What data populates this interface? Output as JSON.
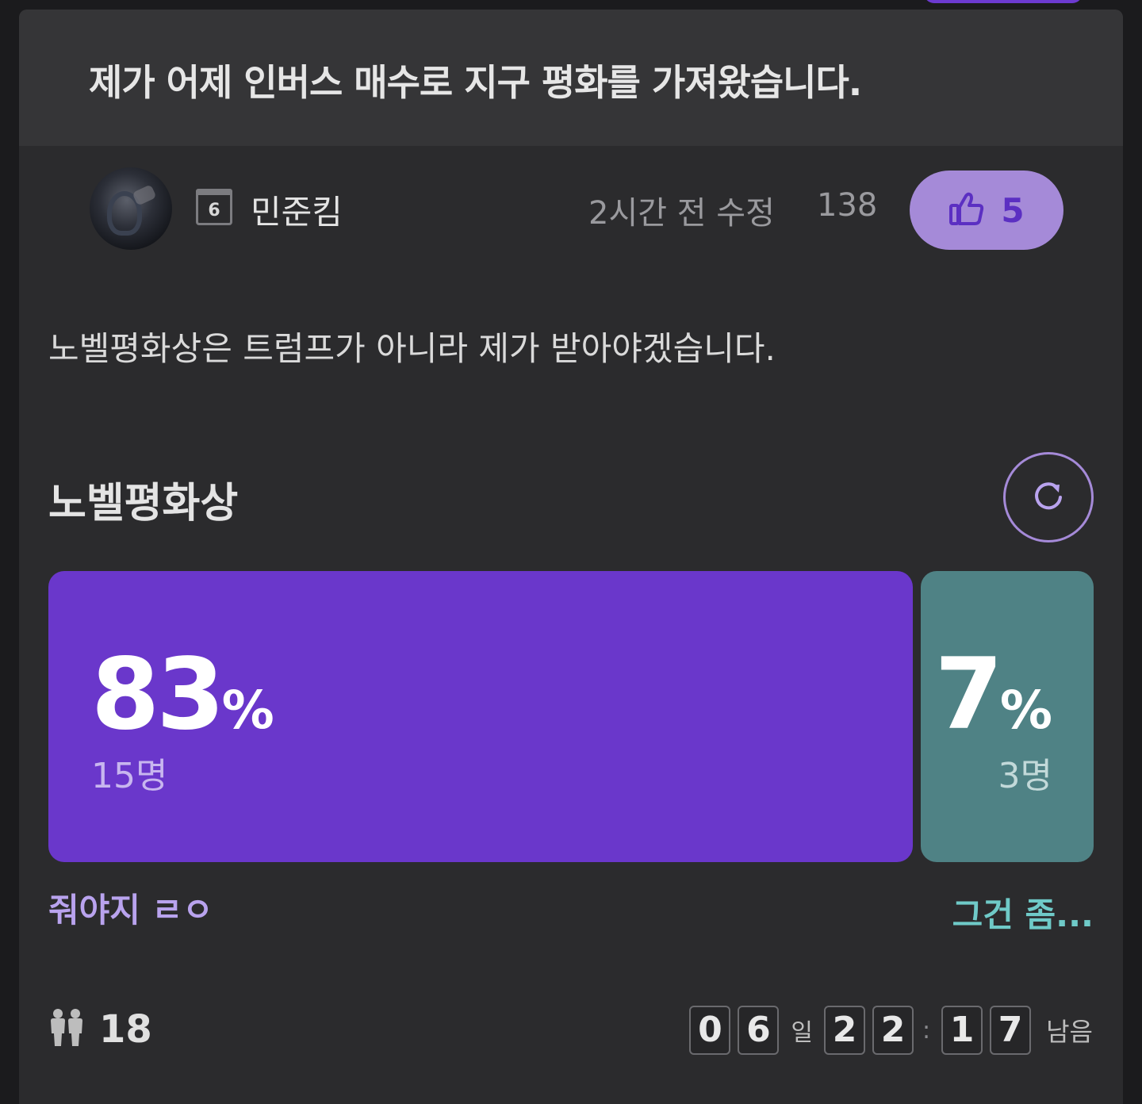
{
  "post": {
    "title": "제가 어제 인버스 매수로 지구 평화를 가져왔습니다.",
    "author": "민준킴",
    "level": "6",
    "edited": "2시간 전 수정",
    "views": "138",
    "likes": "5",
    "body": "노벨평화상은 트럼프가 아니라 제가 받아야겠습니다."
  },
  "poll": {
    "title": "노벨평화상",
    "options": [
      {
        "percent": "83",
        "percent_sign": "%",
        "count": "15명",
        "label": "줘야지 ㄹㅇ",
        "color": "#6a37cb"
      },
      {
        "percent": "7",
        "percent_sign": "%",
        "count": "3명",
        "label": "그건 좀...",
        "color": "#4f8285"
      }
    ],
    "participants": "18",
    "timer": {
      "days": [
        "0",
        "6"
      ],
      "day_unit": "일",
      "hours": [
        "2",
        "2"
      ],
      "separator": ":",
      "minutes": [
        "1",
        "7"
      ],
      "remaining_label": "남음"
    }
  },
  "colors": {
    "accent_purple": "#6a37cb",
    "accent_teal": "#4f8285",
    "like_bg": "#a58ad8"
  },
  "icons": {
    "like": "thumbs-up-icon",
    "refresh": "refresh-icon",
    "participants": "people-icon",
    "level": "calendar-badge-icon"
  }
}
